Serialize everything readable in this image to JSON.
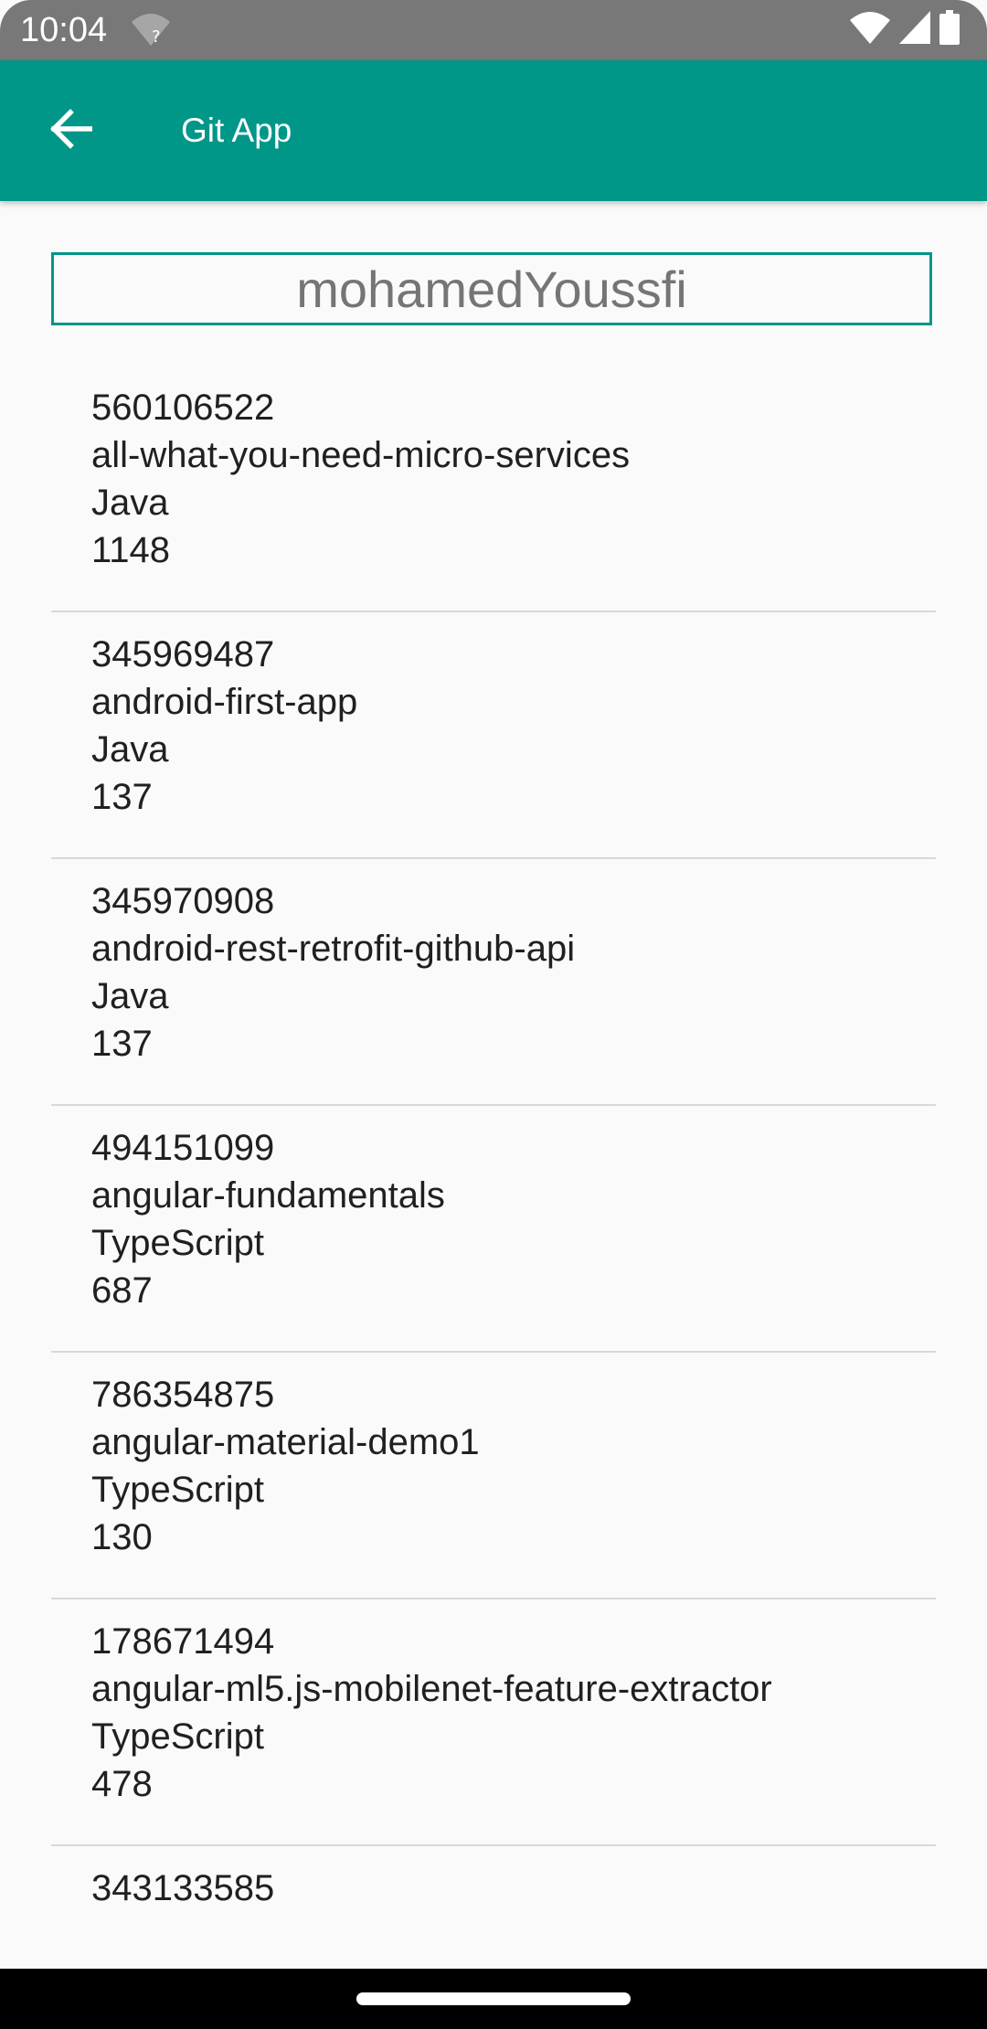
{
  "status_bar": {
    "time": "10:04",
    "icons": [
      "wifi-unknown-icon",
      "wifi-icon",
      "cell-signal-icon",
      "battery-icon"
    ]
  },
  "app_bar": {
    "title": "Git App",
    "back_icon": "arrow-back-icon",
    "color": "#009688"
  },
  "search": {
    "value": "mohamedYoussfi"
  },
  "repos": [
    {
      "id": "560106522",
      "name": "all-what-you-need-micro-services",
      "language": "Java",
      "size": "1148"
    },
    {
      "id": "345969487",
      "name": "android-first-app",
      "language": "Java",
      "size": "137"
    },
    {
      "id": "345970908",
      "name": "android-rest-retrofit-github-api",
      "language": "Java",
      "size": "137"
    },
    {
      "id": "494151099",
      "name": "angular-fundamentals",
      "language": "TypeScript",
      "size": "687"
    },
    {
      "id": "786354875",
      "name": "angular-material-demo1",
      "language": "TypeScript",
      "size": "130"
    },
    {
      "id": "178671494",
      "name": "angular-ml5.js-mobilenet-feature-extractor",
      "language": "TypeScript",
      "size": "478"
    },
    {
      "id": "343133585"
    }
  ]
}
